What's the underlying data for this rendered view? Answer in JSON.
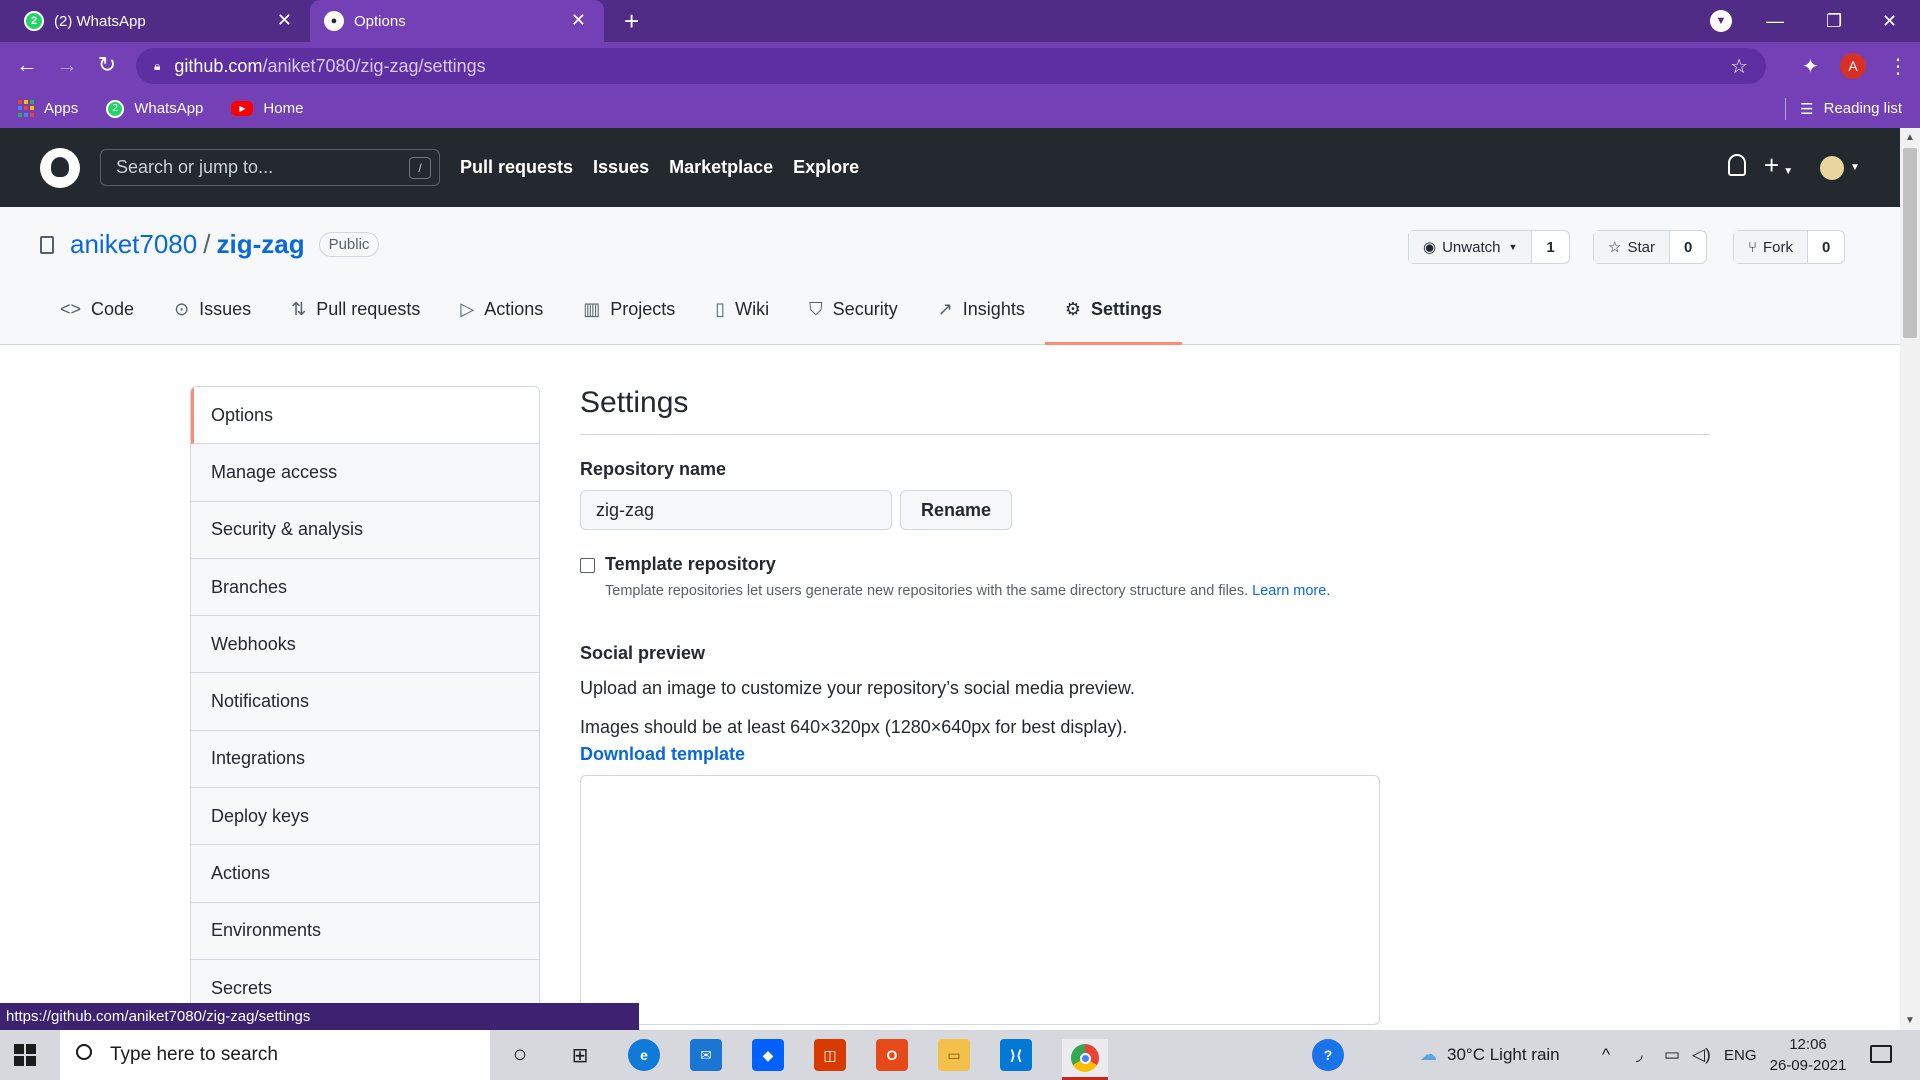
{
  "browser": {
    "tabs": [
      {
        "title": "(2) WhatsApp",
        "favicon": "whatsapp-icon",
        "badge": "2"
      },
      {
        "title": "Options",
        "favicon": "github-icon"
      }
    ],
    "url": {
      "host": "github.com",
      "path": "/aniket7080/zig-zag/settings"
    },
    "profile_initial": "A",
    "bookmarks": [
      {
        "label": "Apps",
        "icon": "apps-grid-icon"
      },
      {
        "label": "WhatsApp",
        "icon": "whatsapp-icon"
      },
      {
        "label": "Home",
        "icon": "youtube-icon"
      }
    ],
    "reading_list": "Reading list",
    "status_url": "https://github.com/aniket7080/zig-zag/settings",
    "colors": {
      "chrome": "#512c86",
      "toolbar": "#7340b5"
    }
  },
  "github": {
    "search_placeholder": "Search or jump to...",
    "search_key": "/",
    "nav": [
      "Pull requests",
      "Issues",
      "Marketplace",
      "Explore"
    ],
    "plus": "+"
  },
  "repo": {
    "owner": "aniket7080",
    "name": "zig-zag",
    "separator": "/",
    "visibility": "Public",
    "actions": [
      {
        "label": "Unwatch",
        "count": "1",
        "icon": "eye-icon"
      },
      {
        "label": "Star",
        "count": "0",
        "icon": "star-icon"
      },
      {
        "label": "Fork",
        "count": "0",
        "icon": "fork-icon"
      }
    ],
    "tabs": [
      {
        "label": "Code",
        "icon": "code-icon"
      },
      {
        "label": "Issues",
        "icon": "issue-icon"
      },
      {
        "label": "Pull requests",
        "icon": "pull-request-icon"
      },
      {
        "label": "Actions",
        "icon": "play-icon"
      },
      {
        "label": "Projects",
        "icon": "project-icon"
      },
      {
        "label": "Wiki",
        "icon": "book-icon"
      },
      {
        "label": "Security",
        "icon": "shield-icon"
      },
      {
        "label": "Insights",
        "icon": "graph-icon"
      },
      {
        "label": "Settings",
        "icon": "gear-icon"
      }
    ],
    "active_tab": "Settings"
  },
  "settings_menu": {
    "items": [
      "Options",
      "Manage access",
      "Security & analysis",
      "Branches",
      "Webhooks",
      "Notifications",
      "Integrations",
      "Deploy keys",
      "Actions",
      "Environments",
      "Secrets"
    ],
    "active": "Options"
  },
  "settings": {
    "heading": "Settings",
    "repo_name_label": "Repository name",
    "repo_name_value": "zig-zag",
    "rename_button": "Rename",
    "template_label": "Template repository",
    "template_checked": false,
    "template_note": "Template repositories let users generate new repositories with the same directory structure and files.",
    "learn_more": "Learn more.",
    "social_title": "Social preview",
    "social_desc": "Upload an image to customize your repository’s social media preview.",
    "social_size": "Images should be at least 640×320px (1280×640px for best display).",
    "download_template": "Download template"
  },
  "taskbar": {
    "search_placeholder": "Type here to search",
    "weather": "30°C  Light rain",
    "language": "ENG",
    "time": "12:06",
    "date": "26-09-2021"
  }
}
